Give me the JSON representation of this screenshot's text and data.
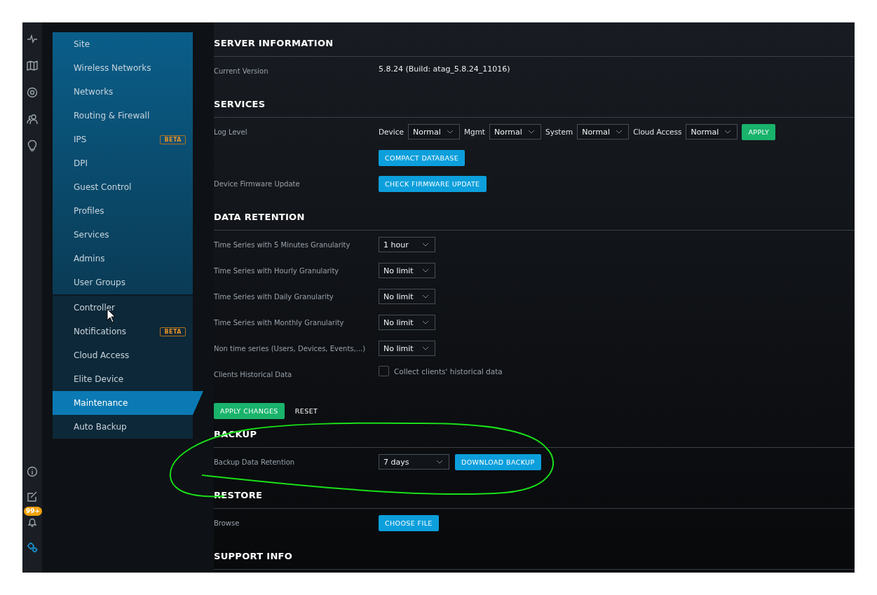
{
  "rail": {
    "badge": "99+"
  },
  "sidebar": {
    "groups": [
      {
        "items": [
          {
            "label": "Site",
            "selected": false
          },
          {
            "label": "Wireless Networks",
            "selected": false
          },
          {
            "label": "Networks",
            "selected": false
          },
          {
            "label": "Routing & Firewall",
            "selected": false
          },
          {
            "label": "IPS",
            "badge": "BETA",
            "selected": false
          },
          {
            "label": "DPI",
            "selected": false
          },
          {
            "label": "Guest Control",
            "selected": false
          },
          {
            "label": "Profiles",
            "selected": false
          },
          {
            "label": "Services",
            "selected": false
          },
          {
            "label": "Admins",
            "selected": false
          },
          {
            "label": "User Groups",
            "selected": false
          }
        ]
      },
      {
        "items": [
          {
            "label": "Controller",
            "selected": false
          },
          {
            "label": "Notifications",
            "badge": "BETA",
            "selected": false
          },
          {
            "label": "Cloud Access",
            "selected": false
          },
          {
            "label": "Elite Device",
            "selected": false
          },
          {
            "label": "Maintenance",
            "selected": true
          },
          {
            "label": "Auto Backup",
            "selected": false
          }
        ]
      }
    ]
  },
  "sections": [
    {
      "title": "SERVER INFORMATION",
      "rows": [
        {
          "label": "Current Version",
          "controls": [
            {
              "kind": "value",
              "text": "5.8.24 (Build: atag_5.8.24_11016)"
            }
          ]
        }
      ]
    },
    {
      "title": "SERVICES",
      "rows": [
        {
          "label": "Log Level",
          "controls": [
            {
              "kind": "text",
              "text": "Device"
            },
            {
              "kind": "select",
              "value": "Normal"
            },
            {
              "kind": "text",
              "text": "Mgmt"
            },
            {
              "kind": "select",
              "value": "Normal"
            },
            {
              "kind": "text",
              "text": "System"
            },
            {
              "kind": "select",
              "value": "Normal"
            },
            {
              "kind": "text",
              "text": "Cloud Access"
            },
            {
              "kind": "select",
              "value": "Normal"
            },
            {
              "kind": "confirm",
              "text": "APPLY"
            }
          ]
        },
        {
          "controls": [
            {
              "kind": "button",
              "text": "COMPACT DATABASE"
            }
          ]
        },
        {
          "label": "Device Firmware Update",
          "controls": [
            {
              "kind": "button",
              "text": "CHECK FIRMWARE UPDATE"
            }
          ]
        }
      ]
    },
    {
      "title": "DATA RETENTION",
      "rows": [
        {
          "label": "Time Series with 5 Minutes Granularity",
          "controls": [
            {
              "kind": "select",
              "value": "1 hour"
            }
          ]
        },
        {
          "label": "Time Series with Hourly Granularity",
          "controls": [
            {
              "kind": "select",
              "value": "No limit"
            }
          ]
        },
        {
          "label": "Time Series with Daily Granularity",
          "controls": [
            {
              "kind": "select",
              "value": "No limit"
            }
          ]
        },
        {
          "label": "Time Series with Monthly Granularity",
          "controls": [
            {
              "kind": "select",
              "value": "No limit"
            }
          ]
        },
        {
          "label": "Non time series (Users, Devices, Events,...)",
          "controls": [
            {
              "kind": "select",
              "value": "No limit"
            }
          ]
        },
        {
          "label": "Clients Historical Data",
          "controls": [
            {
              "kind": "checkbox",
              "checked": false,
              "text": "Collect clients' historical data"
            }
          ]
        }
      ],
      "actions": [
        {
          "kind": "confirm",
          "text": "APPLY CHANGES"
        },
        {
          "kind": "link",
          "text": "RESET"
        }
      ]
    },
    {
      "title": "BACKUP",
      "rows": [
        {
          "label": "Backup Data Retention",
          "controls": [
            {
              "kind": "select",
              "value": "7 days"
            },
            {
              "kind": "button",
              "text": "DOWNLOAD BACKUP"
            }
          ]
        }
      ]
    },
    {
      "title": "RESTORE",
      "rows": [
        {
          "label": "Browse",
          "controls": [
            {
              "kind": "button",
              "text": "CHOOSE FILE"
            }
          ]
        }
      ]
    },
    {
      "title": "SUPPORT INFO"
    }
  ]
}
